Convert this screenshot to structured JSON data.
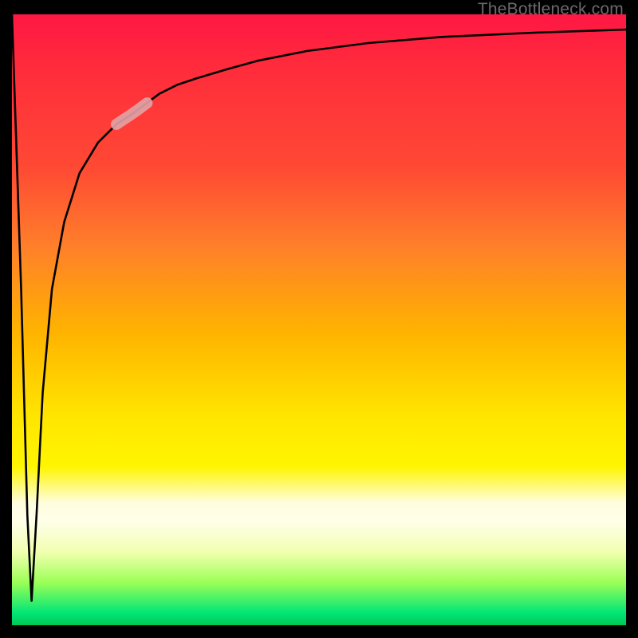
{
  "attribution": "TheBottleneck.com",
  "chart_data": {
    "type": "line",
    "title": "",
    "xlabel": "",
    "ylabel": "",
    "xlim": [
      0,
      100
    ],
    "ylim": [
      0,
      100
    ],
    "background_gradient": {
      "top": "#ff1744",
      "mid": "#ffe600",
      "bottom": "#00c853"
    },
    "series": [
      {
        "name": "bottleneck-curve",
        "x": [
          0.0,
          1.5,
          2.5,
          3.2,
          4.0,
          5.0,
          6.5,
          8.5,
          11.0,
          14.0,
          17.0,
          20.0,
          24.0,
          27.0,
          30.0,
          35.0,
          40.0,
          48.0,
          58.0,
          70.0,
          85.0,
          100.0
        ],
        "y": [
          100.0,
          55.0,
          18.0,
          4.0,
          18.0,
          38.0,
          55.0,
          66.0,
          74.0,
          79.0,
          82.0,
          84.0,
          87.0,
          88.5,
          89.5,
          91.0,
          92.4,
          94.0,
          95.3,
          96.3,
          97.0,
          97.5
        ]
      }
    ],
    "highlight_segment": {
      "color": "#e2a3a6",
      "x_start": 17.0,
      "x_end": 22.0
    }
  }
}
